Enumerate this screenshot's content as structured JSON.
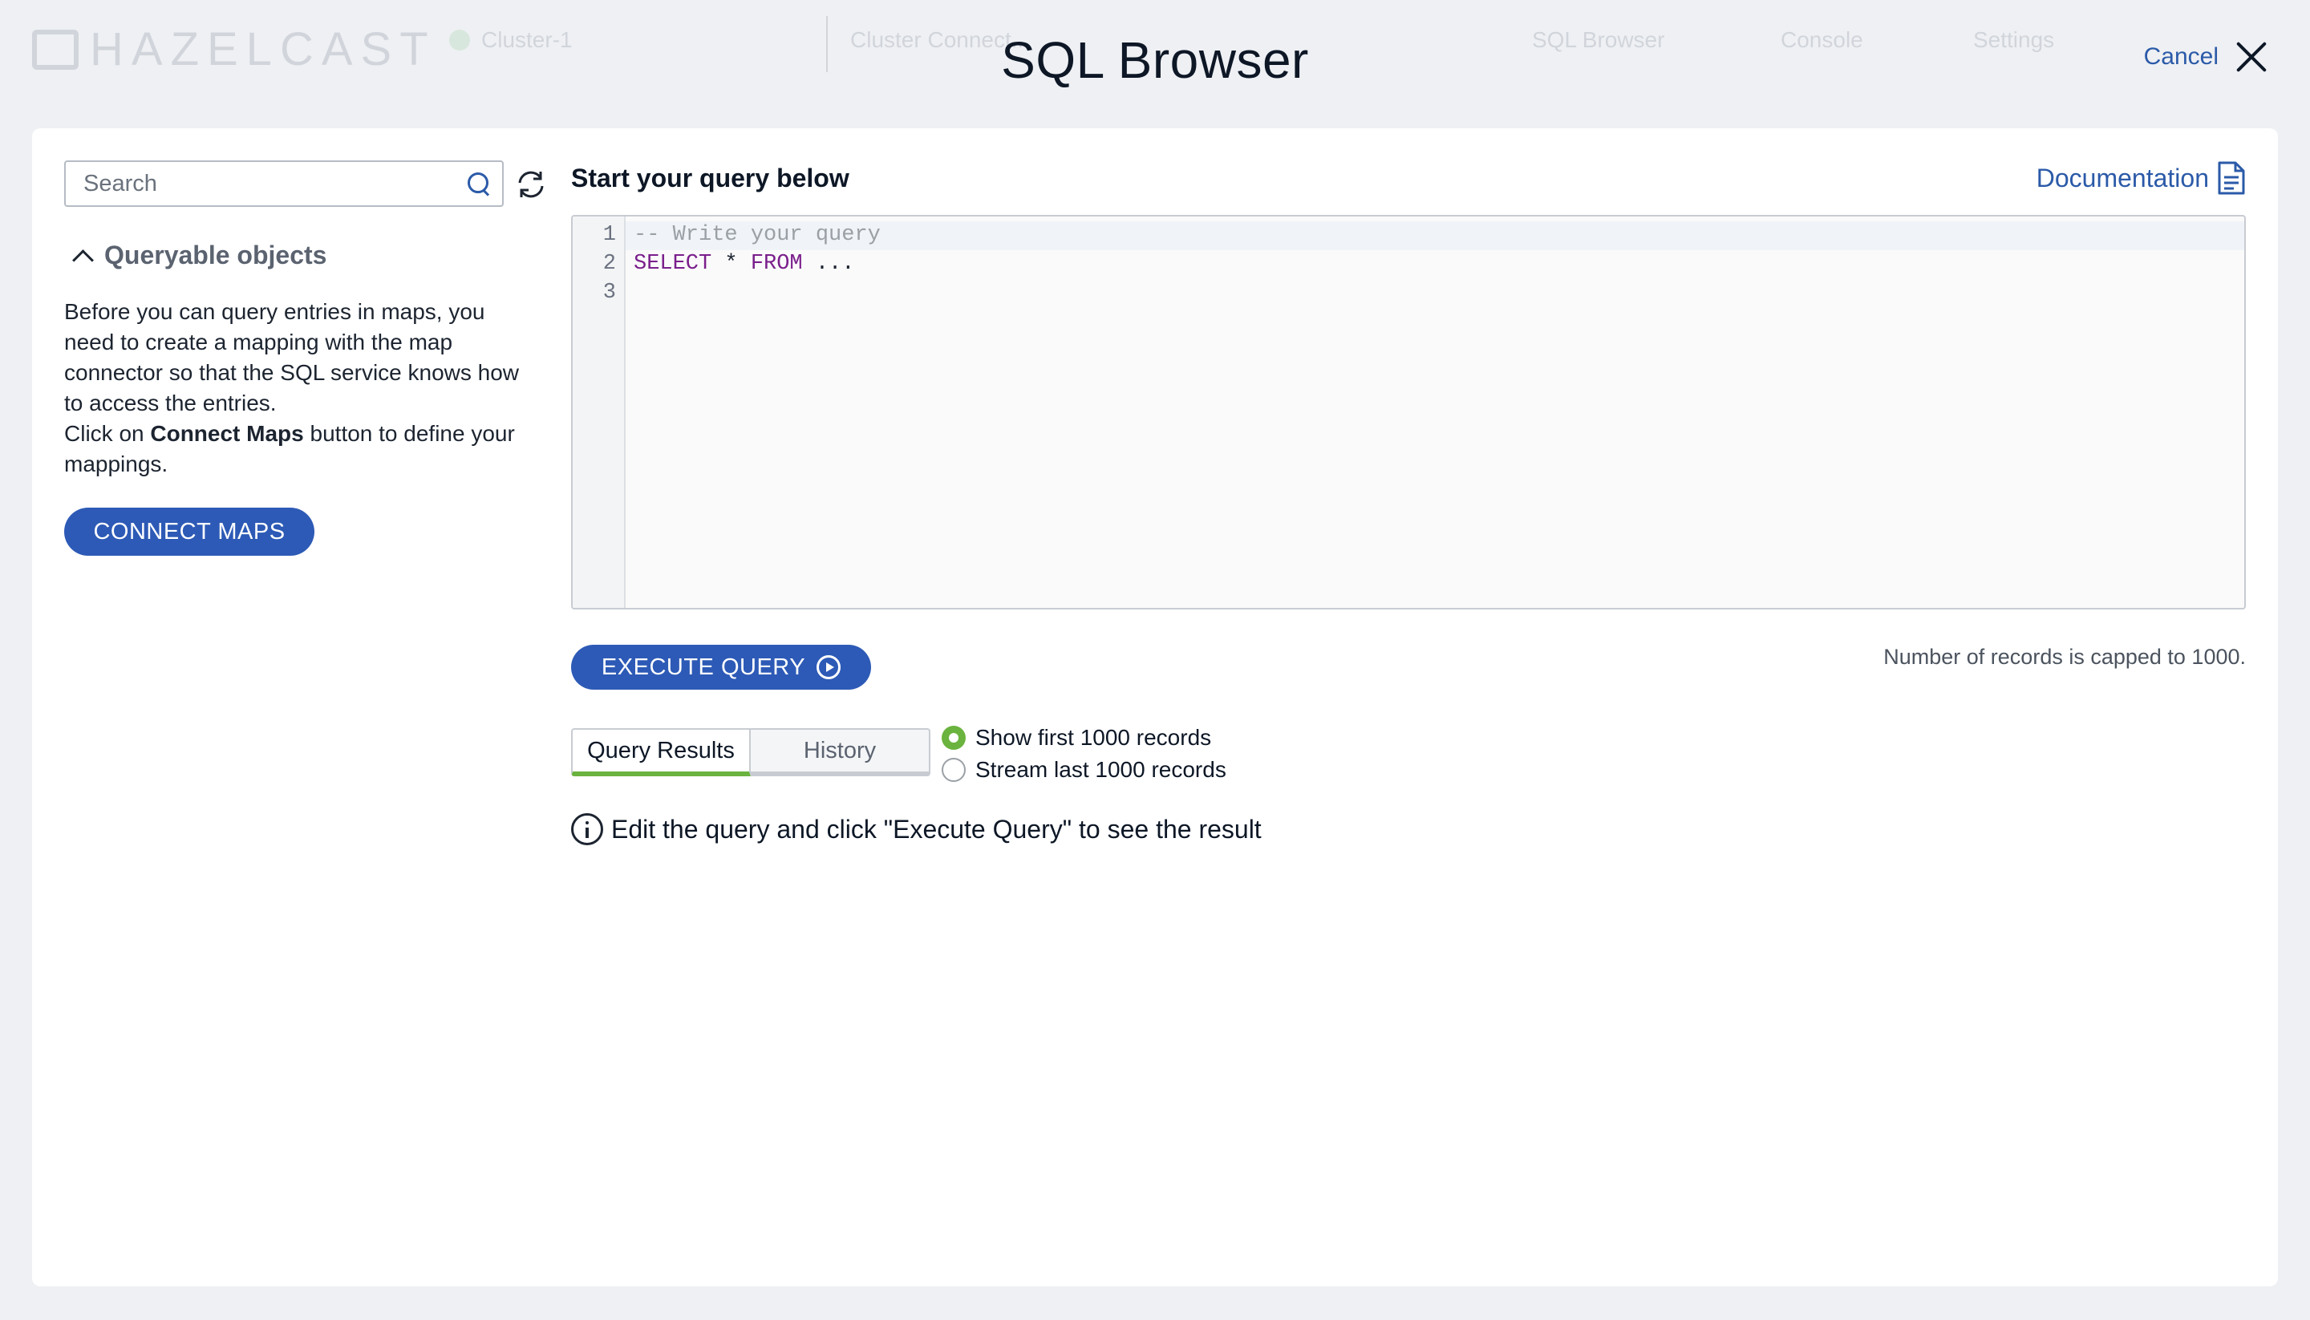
{
  "background": {
    "logo": "HAZELCAST",
    "cluster": "Cluster-1",
    "connection": "Cluster Connect...",
    "nav": [
      "SQL Browser",
      "Console",
      "Settings"
    ]
  },
  "modal": {
    "title": "SQL Browser",
    "cancel_label": "Cancel"
  },
  "sidebar": {
    "search_placeholder": "Search",
    "section_title": "Queryable objects",
    "info_line1": "Before you can query entries in maps, you need to create a mapping with the map connector so that the SQL service knows how to access the entries.",
    "info_click": "Click on ",
    "info_bold": "Connect Maps",
    "info_rest": " button to define your mappings.",
    "connect_button": "CONNECT MAPS"
  },
  "query": {
    "heading": "Start your query below",
    "documentation": "Documentation",
    "lines": [
      {
        "num": "1",
        "text": "-- Write your query"
      },
      {
        "num": "2",
        "kw1": "SELECT",
        "mid": " * ",
        "kw2": "FROM",
        "rest": " ..."
      },
      {
        "num": "3",
        "text": ""
      }
    ],
    "execute_button": "EXECUTE QUERY",
    "cap_note": "Number of records is capped to 1000."
  },
  "results": {
    "tabs": [
      "Query Results",
      "History"
    ],
    "radio_options": [
      "Show first 1000 records",
      "Stream last 1000 records"
    ],
    "hint": "Edit the query and click \"Execute Query\" to see the result"
  },
  "colors": {
    "primary": "#2d5ab6",
    "link": "#2b5aa8",
    "accent_green": "#6ab33e"
  }
}
